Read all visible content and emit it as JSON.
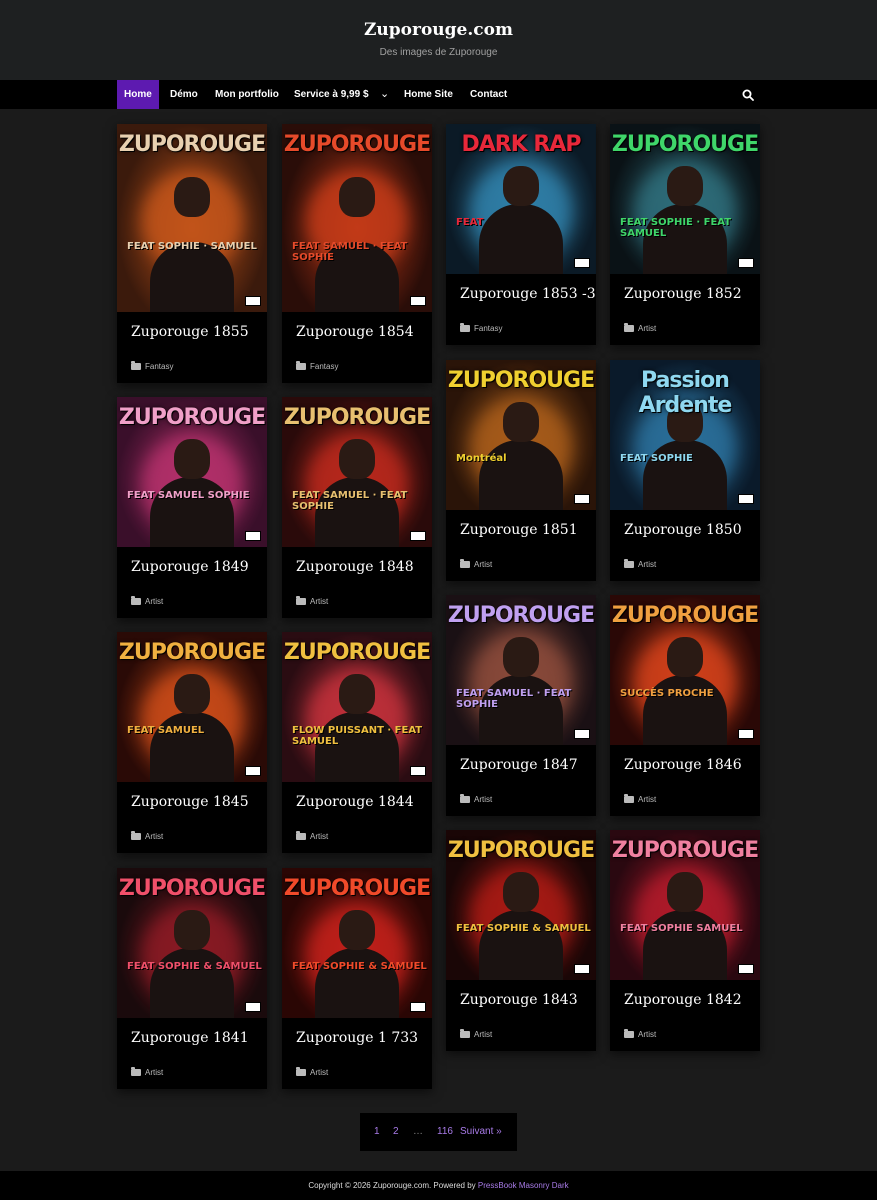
{
  "site": {
    "title": "Zuporouge.com",
    "description": "Des images de Zuporouge"
  },
  "nav": {
    "items": [
      {
        "label": "Home",
        "active": true
      },
      {
        "label": "Démo"
      },
      {
        "label": "Mon portfolio"
      },
      {
        "label": "Service à 9,99 $"
      },
      {
        "label": "Home Site"
      },
      {
        "label": "Contact"
      }
    ],
    "search_icon": "search-icon",
    "dropdown_icon": "chevron-down-icon",
    "accent_color": "#5d1ab0"
  },
  "posts": [
    {
      "title": "Zuporouge 1855",
      "category": "Fantasy",
      "art_text": "ZUPOROUGE",
      "art_feat": "FEAT SOPHIE · SAMUEL",
      "palette": [
        "#3b1a0c",
        "#c2541a",
        "#e8d0b0"
      ]
    },
    {
      "title": "Zuporouge 1854",
      "category": "Fantasy",
      "art_text": "ZUPOROUGE",
      "art_feat": "FEAT SAMUEL · FEAT SOPHIE",
      "palette": [
        "#2a0d08",
        "#c23a18",
        "#e64a2a"
      ]
    },
    {
      "title": "Zuporouge 1853 -3",
      "category": "Fantasy",
      "art_text": "DARK RAP",
      "art_feat": "FEAT",
      "palette": [
        "#0b1a26",
        "#2f7fa8",
        "#e8283a"
      ]
    },
    {
      "title": "Zuporouge 1852",
      "category": "Artist",
      "art_text": "ZUPOROUGE",
      "art_feat": "FEAT SOPHIE · FEAT SAMUEL",
      "palette": [
        "#0a1216",
        "#2e6d7a",
        "#3fd66a"
      ]
    },
    {
      "title": "Zuporouge 1849",
      "category": "Artist",
      "art_text": "ZUPOROUGE",
      "art_feat": "FEAT SAMUEL SOPHIE",
      "palette": [
        "#3a0f2a",
        "#b3306a",
        "#f0a0c8"
      ]
    },
    {
      "title": "Zuporouge 1848",
      "category": "Artist",
      "art_text": "ZUPOROUGE",
      "art_feat": "FEAT SAMUEL · FEAT SOPHIE",
      "palette": [
        "#2a0a0a",
        "#b8281c",
        "#e8c070"
      ]
    },
    {
      "title": "Zuporouge 1851",
      "category": "Artist",
      "art_text": "ZUPOROUGE",
      "art_feat": "Montréal",
      "palette": [
        "#2a1408",
        "#a85c1a",
        "#f0d030"
      ]
    },
    {
      "title": "Zuporouge 1850",
      "category": "Artist",
      "art_text": "Passion Ardente",
      "art_feat": "FEAT SOPHIE",
      "palette": [
        "#0a1a2a",
        "#2a6f9a",
        "#8fd8f0"
      ]
    },
    {
      "title": "Zuporouge 1845",
      "category": "Artist",
      "art_text": "ZUPOROUGE",
      "art_feat": "FEAT SAMUEL",
      "palette": [
        "#2a0a06",
        "#c84a18",
        "#f0b040"
      ]
    },
    {
      "title": "Zuporouge 1844",
      "category": "Artist",
      "art_text": "ZUPOROUGE",
      "art_feat": "FLOW PUISSANT · FEAT SAMUEL",
      "palette": [
        "#2a0c12",
        "#c0303a",
        "#f0c040"
      ]
    },
    {
      "title": "Zuporouge 1847",
      "category": "Artist",
      "art_text": "ZUPOROUGE",
      "art_feat": "FEAT SAMUEL · FEAT SOPHIE",
      "palette": [
        "#1a1014",
        "#8a4a3a",
        "#c0a0f0"
      ]
    },
    {
      "title": "Zuporouge 1846",
      "category": "Artist",
      "art_text": "ZUPOROUGE",
      "art_feat": "SUCCÈS PROCHE",
      "palette": [
        "#2a0806",
        "#d0401a",
        "#f0a040"
      ]
    },
    {
      "title": "Zuporouge 1841",
      "category": "Artist",
      "art_text": "ZUPOROUGE",
      "art_feat": "FEAT SOPHIE & SAMUEL",
      "palette": [
        "#1a0a0c",
        "#8a1a24",
        "#f0506a"
      ]
    },
    {
      "title": "Zuporouge 1 733",
      "category": "Artist",
      "art_text": "ZUPOROUGE",
      "art_feat": "FEAT SOPHIE & SAMUEL",
      "palette": [
        "#2a0604",
        "#c0201a",
        "#f04a2a"
      ]
    },
    {
      "title": "Zuporouge 1843",
      "category": "Artist",
      "art_text": "ZUPOROUGE",
      "art_feat": "FEAT SOPHIE & SAMUEL",
      "palette": [
        "#1a0606",
        "#a81a14",
        "#f0c040"
      ]
    },
    {
      "title": "Zuporouge 1842",
      "category": "Artist",
      "art_text": "ZUPOROUGE",
      "art_feat": "FEAT SOPHIE SAMUEL",
      "palette": [
        "#2a0810",
        "#b01a2a",
        "#f080a0"
      ]
    }
  ],
  "pagination": {
    "pages": [
      "1",
      "2"
    ],
    "ellipsis": "…",
    "last": "116",
    "next": "Suivant »"
  },
  "footer": {
    "copyright": "Copyright © 2026 Zuporouge.com. Powered by",
    "theme_link": "PressBook Masonry Dark"
  }
}
